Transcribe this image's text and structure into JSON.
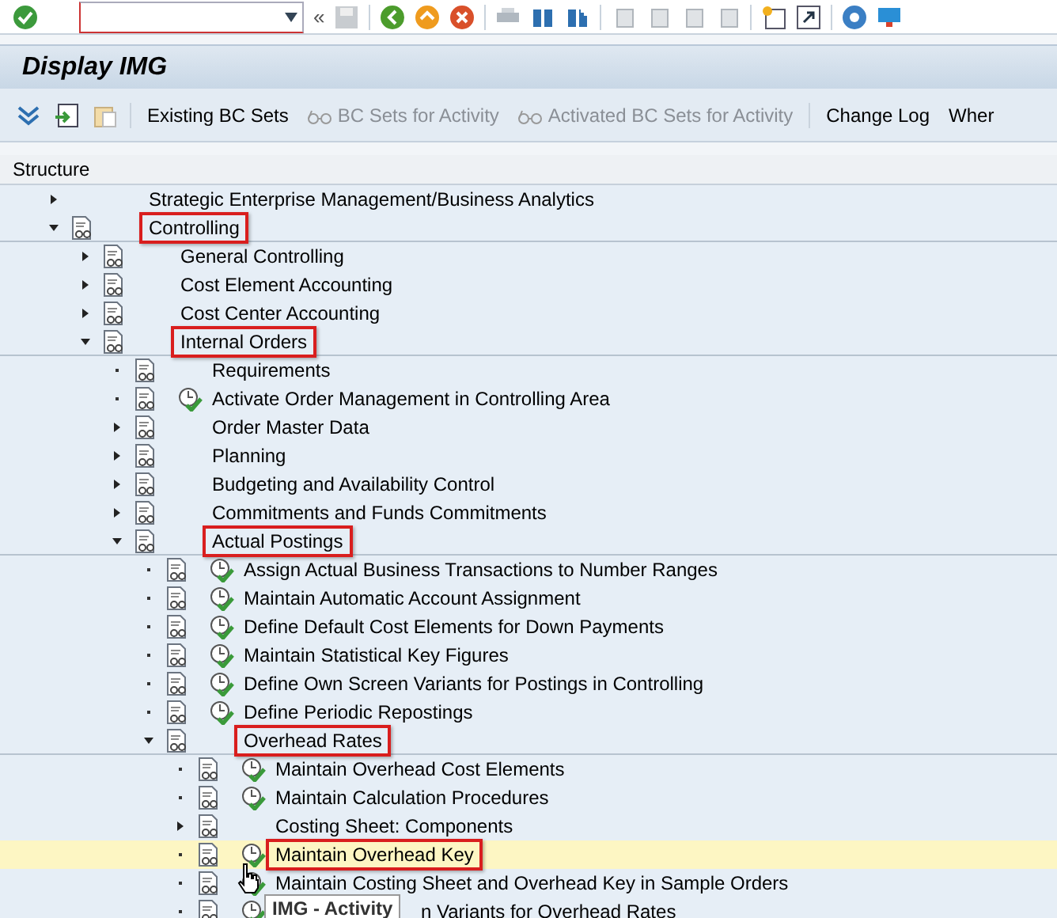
{
  "collapse_button": "«",
  "title": "Display IMG",
  "toolbar": [
    {
      "kind": "icon"
    },
    {
      "kind": "icon"
    },
    {
      "kind": "icon"
    },
    {
      "kind": "separator"
    },
    {
      "kind": "text",
      "label": "Existing BC Sets",
      "disabled": false
    },
    {
      "kind": "glasses",
      "label": "BC Sets for Activity",
      "disabled": true
    },
    {
      "kind": "glasses",
      "label": "Activated BC Sets for Activity",
      "disabled": true
    },
    {
      "kind": "separator"
    },
    {
      "kind": "text",
      "label": "Change Log",
      "disabled": false
    },
    {
      "kind": "text",
      "label": "Wher",
      "disabled": false
    }
  ],
  "tree": {
    "header": "Structure",
    "items": [
      {
        "kind": "node",
        "doc": false,
        "label": "Strategic Enterprise Management/Business Analytics",
        "expanded": false,
        "highlighted": false,
        "selected": false
      },
      {
        "kind": "node",
        "doc": true,
        "label": "Controlling",
        "expanded": true,
        "highlighted": true,
        "selected": false,
        "children": [
          {
            "kind": "node",
            "doc": true,
            "label": "General Controlling",
            "expanded": false,
            "highlighted": false,
            "selected": false
          },
          {
            "kind": "node",
            "doc": true,
            "label": "Cost Element Accounting",
            "expanded": false,
            "highlighted": false,
            "selected": false
          },
          {
            "kind": "node",
            "doc": true,
            "label": "Cost Center Accounting",
            "expanded": false,
            "highlighted": false,
            "selected": false
          },
          {
            "kind": "node",
            "doc": true,
            "label": "Internal Orders",
            "expanded": true,
            "highlighted": true,
            "selected": false,
            "children": [
              {
                "kind": "leaf",
                "doc": true,
                "label": "Requirements",
                "highlighted": false,
                "selected": false
              },
              {
                "kind": "activity",
                "doc": true,
                "label": "Activate Order Management in Controlling Area",
                "highlighted": false,
                "selected": false
              },
              {
                "kind": "node",
                "doc": true,
                "label": "Order Master Data",
                "expanded": false,
                "highlighted": false,
                "selected": false
              },
              {
                "kind": "node",
                "doc": true,
                "label": "Planning",
                "expanded": false,
                "highlighted": false,
                "selected": false
              },
              {
                "kind": "node",
                "doc": true,
                "label": "Budgeting and Availability Control",
                "expanded": false,
                "highlighted": false,
                "selected": false
              },
              {
                "kind": "node",
                "doc": true,
                "label": "Commitments and Funds Commitments",
                "expanded": false,
                "highlighted": false,
                "selected": false
              },
              {
                "kind": "node",
                "doc": true,
                "label": "Actual Postings",
                "expanded": true,
                "highlighted": true,
                "selected": false,
                "children": [
                  {
                    "kind": "activity",
                    "doc": true,
                    "label": "Assign Actual Business Transactions to Number Ranges",
                    "highlighted": false,
                    "selected": false
                  },
                  {
                    "kind": "activity",
                    "doc": true,
                    "label": "Maintain Automatic Account Assignment",
                    "highlighted": false,
                    "selected": false
                  },
                  {
                    "kind": "activity",
                    "doc": true,
                    "label": "Define Default Cost Elements for Down Payments",
                    "highlighted": false,
                    "selected": false
                  },
                  {
                    "kind": "activity",
                    "doc": true,
                    "label": "Maintain Statistical Key Figures",
                    "highlighted": false,
                    "selected": false
                  },
                  {
                    "kind": "activity",
                    "doc": true,
                    "label": "Define Own Screen Variants for Postings in Controlling",
                    "highlighted": false,
                    "selected": false
                  },
                  {
                    "kind": "activity",
                    "doc": true,
                    "label": "Define Periodic Repostings",
                    "highlighted": false,
                    "selected": false
                  },
                  {
                    "kind": "node",
                    "doc": true,
                    "label": "Overhead Rates",
                    "expanded": true,
                    "highlighted": true,
                    "selected": false,
                    "children": [
                      {
                        "kind": "activity",
                        "doc": true,
                        "label": "Maintain Overhead Cost Elements",
                        "highlighted": false,
                        "selected": false
                      },
                      {
                        "kind": "activity",
                        "doc": true,
                        "label": "Maintain Calculation Procedures",
                        "highlighted": false,
                        "selected": false
                      },
                      {
                        "kind": "node",
                        "doc": true,
                        "label": "Costing Sheet: Components",
                        "expanded": false,
                        "highlighted": false,
                        "selected": false
                      },
                      {
                        "kind": "activity",
                        "doc": true,
                        "label": "Maintain Overhead Key",
                        "highlighted": true,
                        "selected": true
                      },
                      {
                        "kind": "activity",
                        "doc": true,
                        "label": "Maintain Costing Sheet and Overhead Key in Sample Orders",
                        "highlighted": false,
                        "selected": false
                      },
                      {
                        "kind": "activity",
                        "doc": true,
                        "label": "n Variants for Overhead Rates",
                        "highlighted": false,
                        "selected": false,
                        "covered": true
                      }
                    ]
                  }
                ]
              }
            ]
          }
        ]
      }
    ]
  },
  "tooltip": "IMG - Activity"
}
